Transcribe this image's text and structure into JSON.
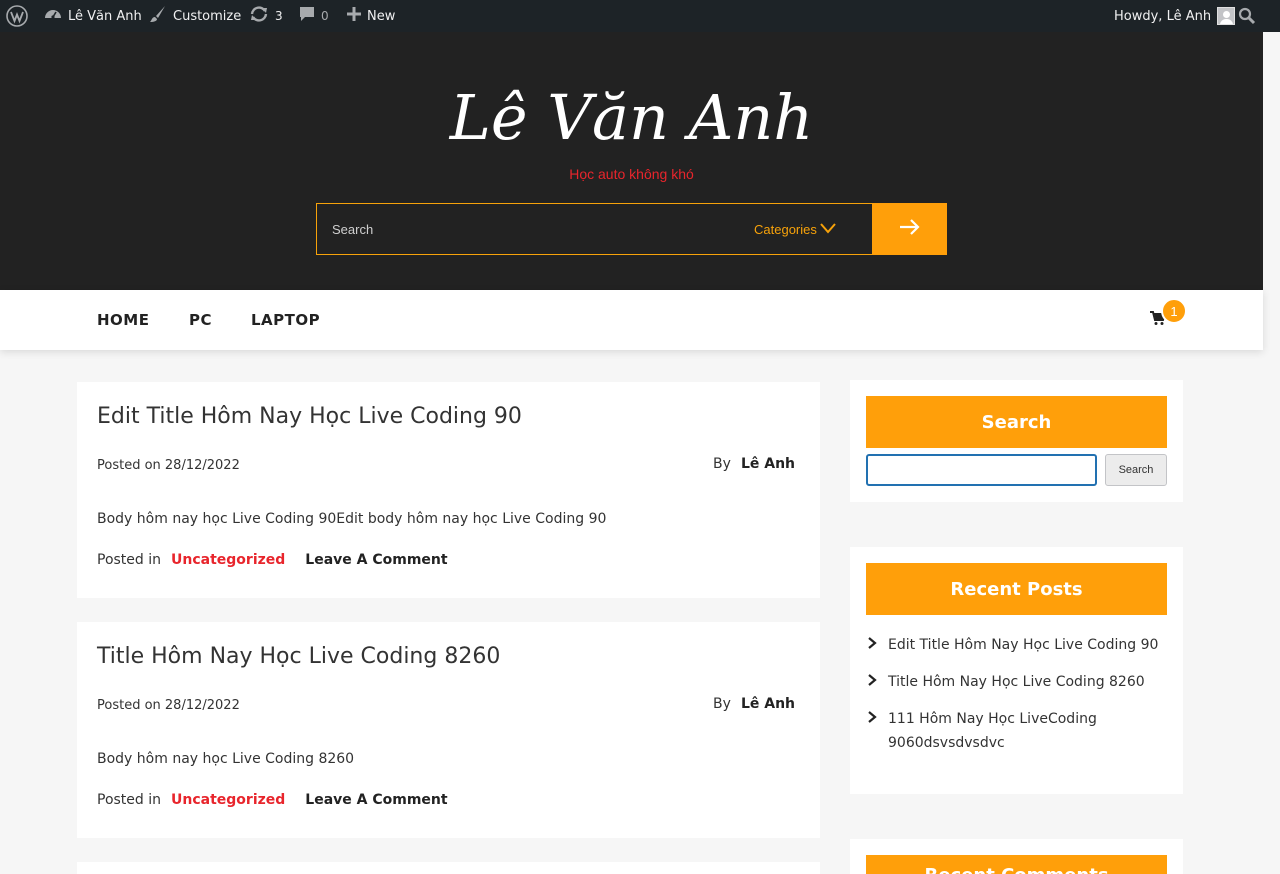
{
  "adminbar": {
    "site_name": "Lê Văn Anh",
    "customize": "Customize",
    "updates_count": "3",
    "comments_count": "0",
    "new_label": "New",
    "howdy": "Howdy, Lê Anh"
  },
  "header": {
    "site_title": "Lê Văn Anh",
    "tagline": "Học auto không khó",
    "search_placeholder": "Search",
    "categories_label": "Categories"
  },
  "nav": {
    "items": [
      {
        "label": "HOME"
      },
      {
        "label": "PC"
      },
      {
        "label": "LAPTOP"
      }
    ],
    "cart_count": "1"
  },
  "posts": [
    {
      "title": "Edit Title Hôm Nay Học Live Coding 90",
      "posted_on": "Posted on 28/12/2022",
      "by_label": "By",
      "author": "Lê Anh",
      "body": "Body hôm nay học Live Coding 90Edit body hôm nay học Live Coding 90",
      "posted_in": "Posted in",
      "category": "Uncategorized",
      "comment_link": "Leave A Comment"
    },
    {
      "title": "Title Hôm Nay Học Live Coding 8260",
      "posted_on": "Posted on 28/12/2022",
      "by_label": "By",
      "author": "Lê Anh",
      "body": "Body hôm nay học Live Coding 8260",
      "posted_in": "Posted in",
      "category": "Uncategorized",
      "comment_link": "Leave A Comment"
    }
  ],
  "sidebar": {
    "search_title": "Search",
    "search_button": "Search",
    "recent_posts_title": "Recent Posts",
    "recent_posts": [
      "Edit Title Hôm Nay Học Live Coding 90",
      "Title Hôm Nay Học Live Coding 8260",
      "111 Hôm Nay Học LiveCoding 9060dsvsdvsdvc"
    ],
    "recent_comments_title": "Recent Comments"
  },
  "colors": {
    "accent": "#ff9f0a",
    "tagline_red": "#e8252c",
    "header_bg": "#222222",
    "adminbar_bg": "#1d2327"
  }
}
